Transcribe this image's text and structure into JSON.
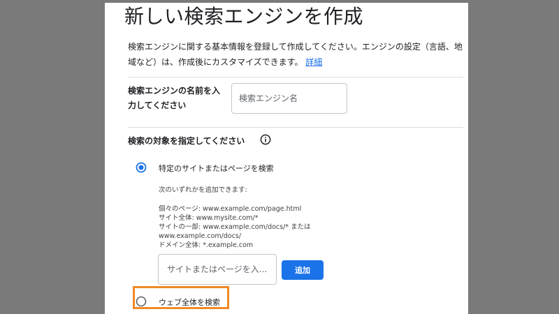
{
  "page": {
    "title": "新しい検索エンジンを作成",
    "description": "検索エンジンに関する基本情報を登録して作成してください。エンジンの設定（言語、地域など）は、作成後にカスタマイズできます。",
    "details_link": "詳細"
  },
  "name_field": {
    "label": "検索エンジンの名前を入力してください",
    "placeholder": "検索エンジン名",
    "value": ""
  },
  "target_section": {
    "heading": "検索の対象を指定してください",
    "info_icon": "info-icon",
    "options": [
      {
        "label": "特定のサイトまたはページを検索",
        "selected": true
      },
      {
        "label": "ウェブ全体を検索",
        "selected": false
      }
    ],
    "hint_intro": "次のいずれかを追加できます:",
    "hint_examples": [
      "個々のページ: www.example.com/page.html",
      "サイト全体: www.mysite.com/*",
      "サイトの一部: www.example.com/docs/* または",
      "www.example.com/docs/",
      "ドメイン全体: *.example.com"
    ],
    "site_input_placeholder": "サイトまたはページを入...",
    "site_input_value": "",
    "add_button": "追加"
  },
  "colors": {
    "primary_blue": "#1a73e8",
    "highlight_orange": "#f08a24",
    "divider": "#dadce0"
  }
}
